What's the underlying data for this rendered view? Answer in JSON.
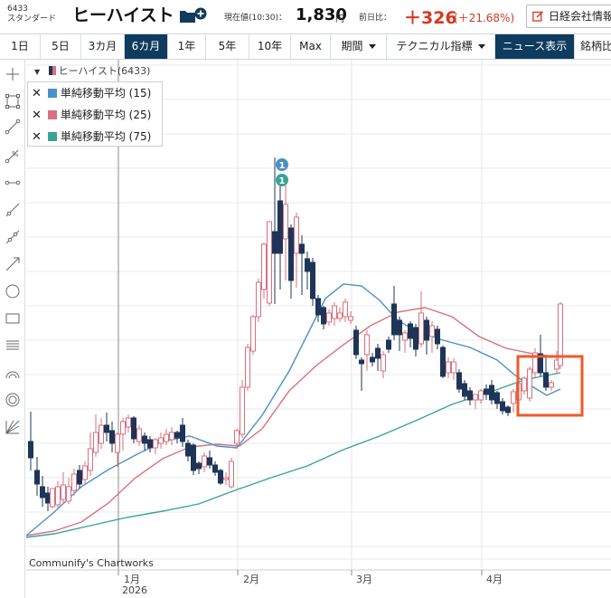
{
  "header": {
    "code": "6433",
    "market": "スタンダード",
    "name": "ヒーハイスト",
    "price_label": "現在値(10:30)：",
    "price": "1,830",
    "price_unit": "円",
    "change_label": "前日比：",
    "change": "＋326",
    "change_pct": "(＋21.68%)",
    "nikkei_button": "日経会社情報"
  },
  "toolbar": {
    "ranges": [
      "1日",
      "5日",
      "3カ月",
      "6カ月",
      "1年",
      "5年",
      "10年",
      "Max"
    ],
    "active_range": "6カ月",
    "period_label": "期間",
    "technical_label": "テクニカル指標",
    "news_label": "ニュース表示",
    "compare_label": "銘柄比"
  },
  "chart_header": {
    "symbol_label": "ヒーハイスト(6433)"
  },
  "legend": [
    {
      "label": "単純移動平均 (15)",
      "color": "#4a90c8"
    },
    {
      "label": "単純移動平均 (25)",
      "color": "#d9707e"
    },
    {
      "label": "単純移動平均 (75)",
      "color": "#3aa396"
    }
  ],
  "chart_data": {
    "type": "candlestick",
    "x_labels": [
      {
        "month": "1月",
        "year": "2026"
      },
      {
        "month": "2月",
        "year": ""
      },
      {
        "month": "3月",
        "year": ""
      },
      {
        "month": "4月",
        "year": ""
      }
    ],
    "news_markers": [
      "1",
      "1"
    ],
    "credit": "Communify's Chartworks",
    "colors": {
      "up": "#d9707e",
      "down": "#1f3557"
    }
  }
}
